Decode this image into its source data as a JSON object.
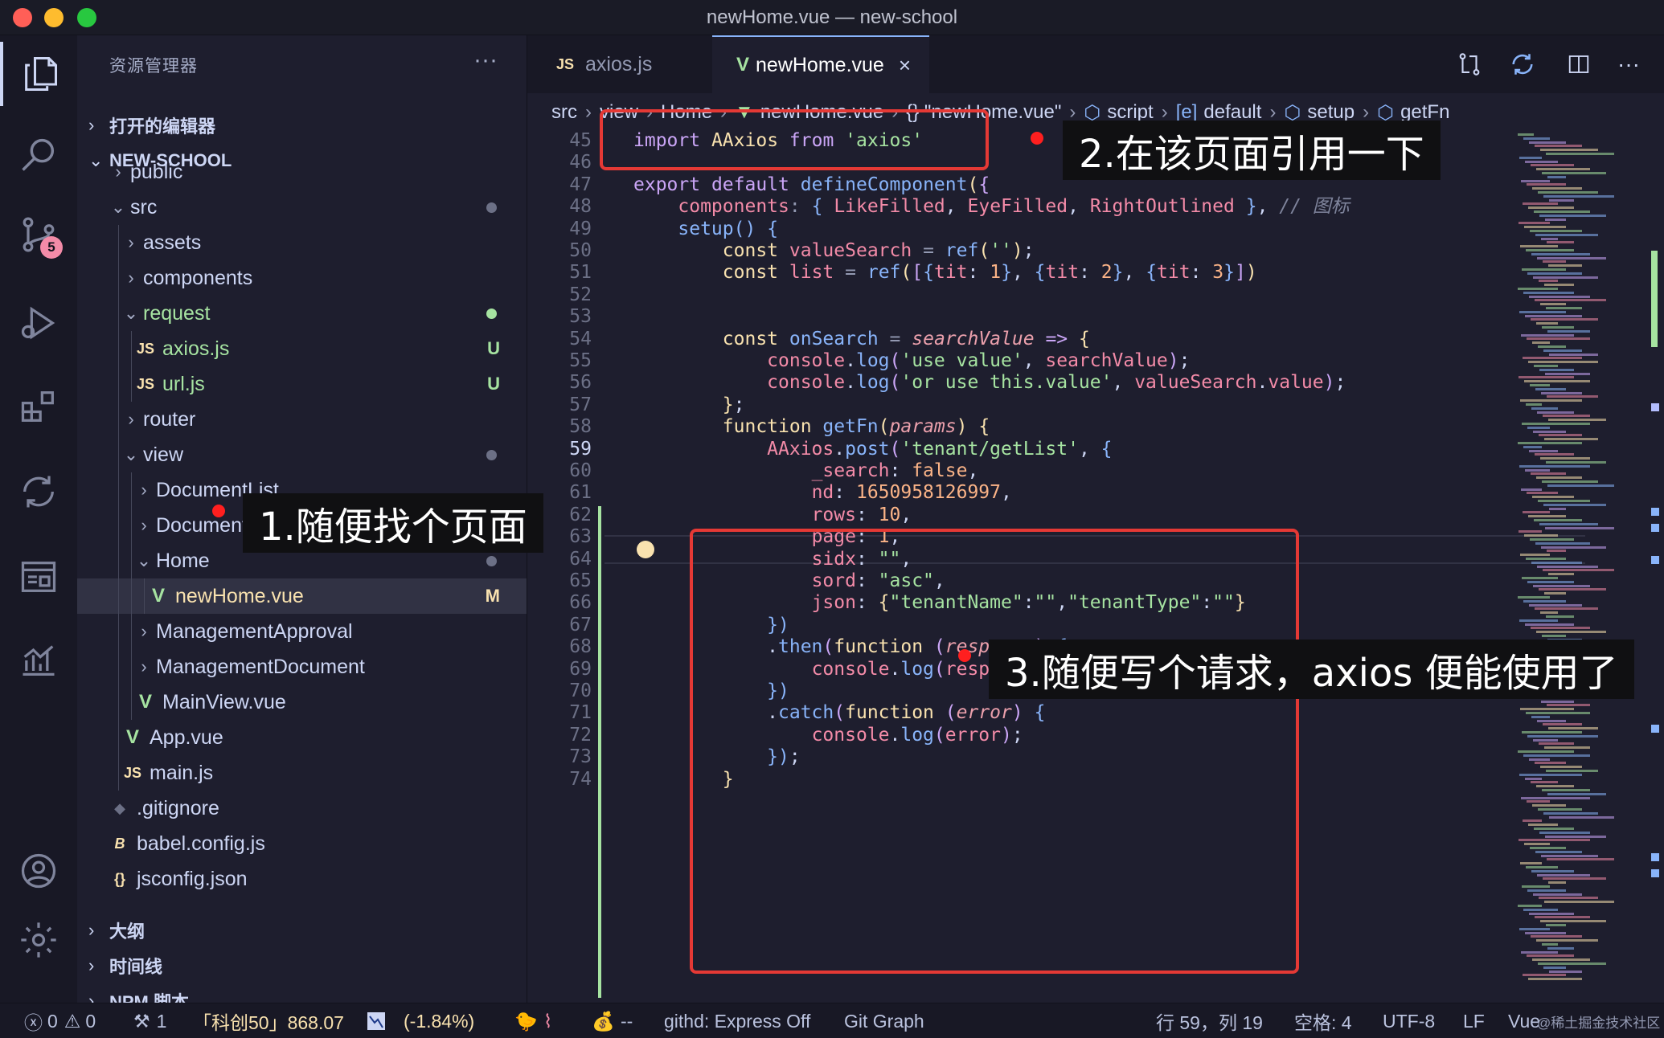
{
  "window": {
    "title": "newHome.vue — new-school"
  },
  "activity_bar": {
    "items": [
      "explorer-icon",
      "search-icon",
      "source-control-icon",
      "run-debug-icon",
      "extensions-icon",
      "git-diff-icon",
      "project-panel-icon",
      "chart-icon",
      "account-icon",
      "settings-gear-icon"
    ],
    "scm_badge": "5"
  },
  "sidebar": {
    "title": "资源管理器",
    "more": "···",
    "open_editors": "打开的编辑器",
    "project": "NEW-SCHOOL",
    "tree": [
      {
        "label": "public",
        "kind": "folder",
        "open": false,
        "depth": 1
      },
      {
        "label": "src",
        "kind": "folder",
        "open": true,
        "depth": 1,
        "dot": "#6c7086"
      },
      {
        "label": "assets",
        "kind": "folder",
        "open": false,
        "depth": 2
      },
      {
        "label": "components",
        "kind": "folder",
        "open": false,
        "depth": 2
      },
      {
        "label": "request",
        "kind": "folder",
        "open": true,
        "depth": 2,
        "dot": "#a6e3a1",
        "color": "green"
      },
      {
        "label": "axios.js",
        "kind": "js",
        "depth": 3,
        "status": "U",
        "color": "green"
      },
      {
        "label": "url.js",
        "kind": "js",
        "depth": 3,
        "status": "U",
        "color": "green"
      },
      {
        "label": "router",
        "kind": "folder",
        "open": false,
        "depth": 2
      },
      {
        "label": "view",
        "kind": "folder",
        "open": true,
        "depth": 2,
        "dot": "#6c7086"
      },
      {
        "label": "DocumentList",
        "kind": "folder",
        "open": false,
        "depth": 3
      },
      {
        "label": "DocumentPush",
        "kind": "folder",
        "open": false,
        "depth": 3
      },
      {
        "label": "Home",
        "kind": "folder",
        "open": true,
        "depth": 3,
        "dot": "#6c7086"
      },
      {
        "label": "newHome.vue",
        "kind": "vue",
        "depth": 4,
        "status": "M",
        "selected": true
      },
      {
        "label": "ManagementApproval",
        "kind": "folder",
        "open": false,
        "depth": 3
      },
      {
        "label": "ManagementDocument",
        "kind": "folder",
        "open": false,
        "depth": 3
      },
      {
        "label": "MainView.vue",
        "kind": "vue",
        "depth": 3
      },
      {
        "label": "App.vue",
        "kind": "vue",
        "depth": 2
      },
      {
        "label": "main.js",
        "kind": "js",
        "depth": 2
      },
      {
        "label": ".gitignore",
        "kind": "git",
        "depth": 1
      },
      {
        "label": "babel.config.js",
        "kind": "babel",
        "depth": 1
      },
      {
        "label": "jsconfig.json",
        "kind": "json",
        "depth": 1
      }
    ],
    "outline": "大纲",
    "timeline": "时间线",
    "npm_scripts": "NPM 脚本"
  },
  "tabs": [
    {
      "label": "axios.js",
      "icon": "JS",
      "active": false
    },
    {
      "label": "newHome.vue",
      "icon": "V",
      "active": true,
      "close": "×"
    }
  ],
  "breadcrumb": [
    "src",
    "view",
    "Home",
    "newHome.vue",
    "{} \"newHome.vue\"",
    "script",
    "default",
    "setup",
    "getFn"
  ],
  "code": {
    "current_line": 59,
    "lines": [
      {
        "n": 45,
        "html": "<span class='kw'>import</span> <span class='ty'>AAxios</span> <span class='kw'>from</span> <span class='st'>'axios'</span>"
      },
      {
        "n": 46,
        "html": ""
      },
      {
        "n": 47,
        "html": "<span class='kw'>export</span> <span class='kw'>default</span> <span class='fn'>defineComponent</span><span class='ty'>(</span><span class='kw'>{</span>"
      },
      {
        "n": 48,
        "html": "    <span class='pr'>components</span><span class='pu'>:</span> <span class='fn'>{</span> <span class='pr'>LikeFilled</span>, <span class='pr'>EyeFilled</span>, <span class='pr'>RightOutlined</span> <span class='fn'>}</span>, <span class='cm'>// 图标</span>"
      },
      {
        "n": 49,
        "html": "    <span class='fn'>setup</span><span class='fn'>()</span> <span class='fn'>{</span>"
      },
      {
        "n": 50,
        "html": "        <span class='ty'>const</span> <span class='pr'>valueSearch</span> <span class='pu'>=</span> <span class='fn'>ref</span><span class='ty'>(</span><span class='st'>''</span><span class='ty'>)</span>;"
      },
      {
        "n": 51,
        "html": "        <span class='ty'>const</span> <span class='pr'>list</span> <span class='pu'>=</span> <span class='fn'>ref</span><span class='ty'>(</span><span class='kw'>[</span><span class='fn'>{</span><span class='pr'>tit</span>: <span class='nu'>1</span><span class='fn'>}</span>, <span class='fn'>{</span><span class='pr'>tit</span>: <span class='nu'>2</span><span class='fn'>}</span>, <span class='fn'>{</span><span class='pr'>tit</span>: <span class='nu'>3</span><span class='fn'>}</span><span class='kw'>]</span><span class='ty'>)</span>"
      },
      {
        "n": 52,
        "html": ""
      },
      {
        "n": 53,
        "html": ""
      },
      {
        "n": 54,
        "html": "        <span class='ty'>const</span> <span class='fn'>onSearch</span> <span class='pu'>=</span> <span class='it'>searchValue</span> <span class='kw'>=&gt;</span> <span class='ty'>{</span>"
      },
      {
        "n": 55,
        "html": "            <span class='pr'>console</span>.<span class='fn'>log</span><span class='kw'>(</span><span class='st'>'use value'</span>, <span class='pr'>searchValue</span><span class='kw'>)</span>;"
      },
      {
        "n": 56,
        "html": "            <span class='pr'>console</span>.<span class='fn'>log</span><span class='kw'>(</span><span class='st'>'or use this.value'</span>, <span class='pr'>valueSearch</span>.<span class='pr'>value</span><span class='kw'>)</span>;"
      },
      {
        "n": 57,
        "html": "        <span class='ty'>}</span>;"
      },
      {
        "n": 58,
        "html": "        <span class='ty'>function</span> <span class='fn'>getFn</span><span class='ty'>(</span><span class='it'>params</span><span class='ty'>)</span> <span class='ty'>{</span>"
      },
      {
        "n": 59,
        "html": "            <span class='pr'>AAxios</span>.<span class='fn'>post</span><span class='kw'>(</span><span class='st'>'tenant/getList'</span>, <span class='fn'>{</span>"
      },
      {
        "n": 60,
        "html": "                <span class='pr'>_search</span>: <span class='bool'>false</span>,"
      },
      {
        "n": 61,
        "html": "                <span class='pr'>nd</span>: <span class='nu'>1650958126997</span>,"
      },
      {
        "n": 62,
        "html": "                <span class='pr'>rows</span>: <span class='nu'>10</span>,"
      },
      {
        "n": 63,
        "html": "                <span class='pr'>page</span>: <span class='nu'>1</span>,"
      },
      {
        "n": 64,
        "html": "                <span class='pr'>sidx</span>: <span class='st'>\"\"</span>,"
      },
      {
        "n": 65,
        "html": "                <span class='pr'>sord</span>: <span class='st'>\"asc\"</span>,"
      },
      {
        "n": 66,
        "html": "                <span class='pr'>json</span>: <span class='ty'>{</span><span class='st'>\"tenantName\"</span>:<span class='st'>\"\"</span>,<span class='st'>\"tenantType\"</span>:<span class='st'>\"\"</span><span class='ty'>}</span>"
      },
      {
        "n": 67,
        "html": "            <span class='fn'>})</span>"
      },
      {
        "n": 68,
        "html": "            .<span class='fn'>then</span><span class='kw'>(</span><span class='ty'>function</span> <span class='kw'>(</span><span class='it'>response</span><span class='kw'>)</span> <span class='fn'>{</span>"
      },
      {
        "n": 69,
        "html": "                <span class='pr'>console</span>.<span class='fn'>log</span><span class='kw'>(</span><span class='pr'>response</span><span class='kw'>)</span>;"
      },
      {
        "n": 70,
        "html": "            <span class='fn'>})</span>"
      },
      {
        "n": 71,
        "html": "            .<span class='fn'>catch</span><span class='kw'>(</span><span class='ty'>function</span> <span class='kw'>(</span><span class='it'>error</span><span class='kw'>)</span> <span class='fn'>{</span>"
      },
      {
        "n": 72,
        "html": "                <span class='pr'>console</span>.<span class='fn'>log</span><span class='kw'>(</span><span class='pr'>error</span><span class='kw'>)</span>;"
      },
      {
        "n": 73,
        "html": "            <span class='fn'>})</span>;"
      },
      {
        "n": 74,
        "html": "        <span class='ty'>}</span>"
      }
    ]
  },
  "annotations": {
    "step1": "1.随便找个页面",
    "step2": "2.在该页面引用一下",
    "step3": "3.随便写个请求，axios 便能使用了",
    "color": "#e53935"
  },
  "statusbar": {
    "errors": "0",
    "warnings": "0",
    "tools": "1",
    "stock_name": "「科创50」868.07",
    "stock_change": "(-1.84%)",
    "dashes": "--",
    "githd": "githd: Express Off",
    "git_graph": "Git Graph",
    "position": "行 59，列 19",
    "indent": "空格: 4",
    "encoding": "UTF-8",
    "eol": "LF",
    "language": "Vue",
    "watermark": "@稀土掘金技术社区"
  }
}
